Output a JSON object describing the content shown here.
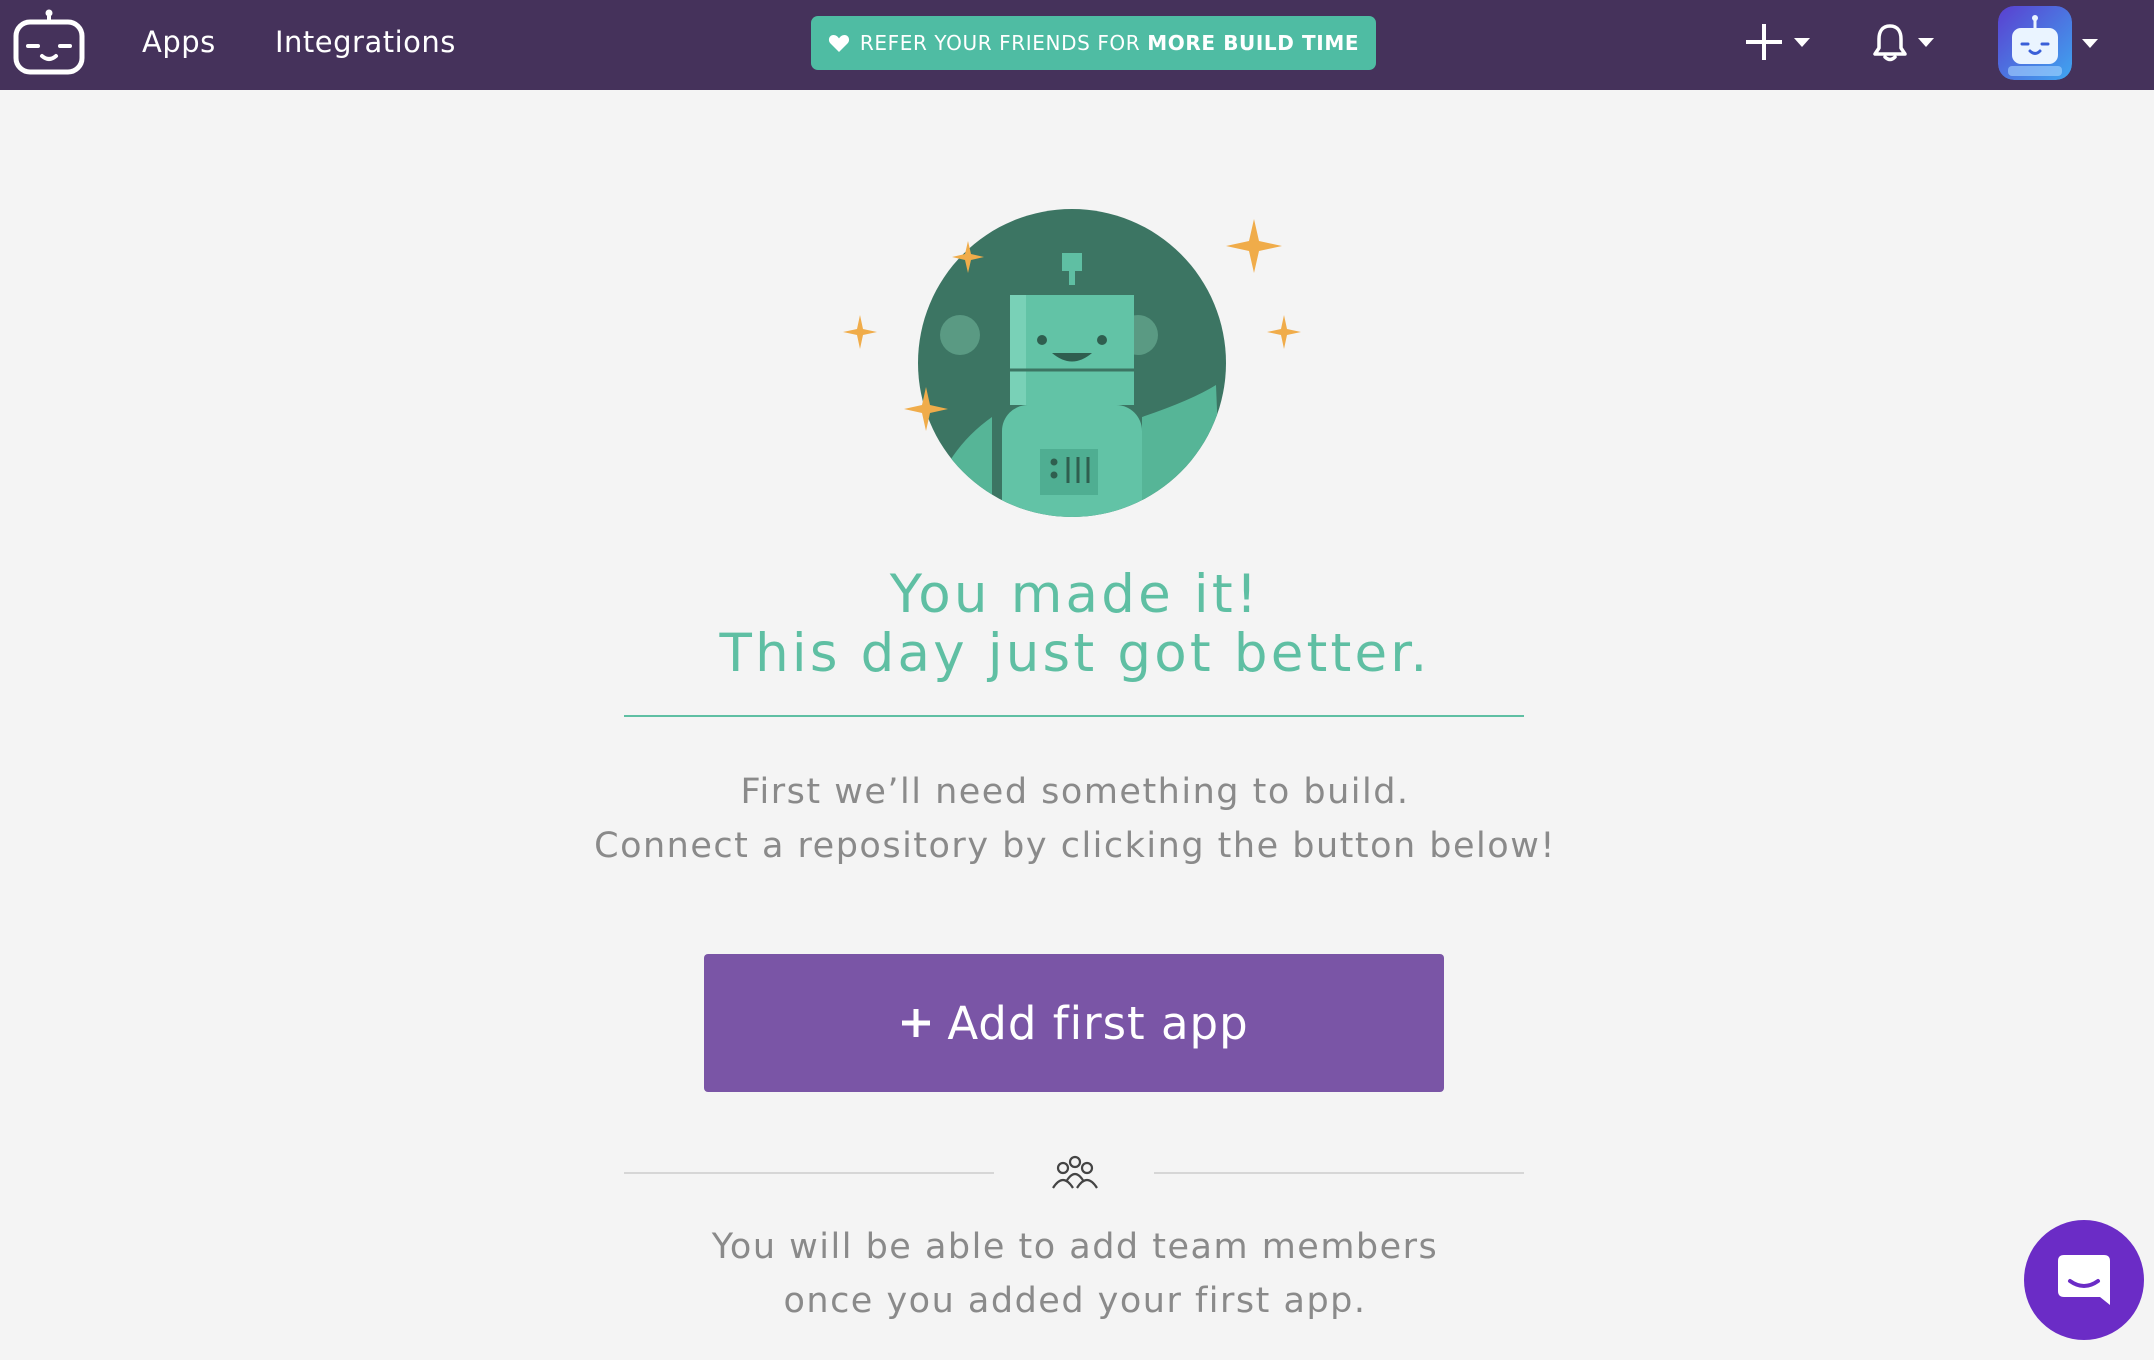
{
  "nav": {
    "logo_icon": "bitrise-bot-logo-icon",
    "links": [
      "Apps",
      "Integrations"
    ],
    "refer": {
      "prefix": "REFER YOUR FRIENDS FOR",
      "emphasis": "MORE BUILD TIME",
      "icon": "heart-icon"
    },
    "actions": {
      "add_icon": "plus-icon",
      "notifications_icon": "bell-icon",
      "avatar_icon": "robot-avatar",
      "dropdown_icon": "caret-down-icon"
    }
  },
  "main": {
    "illustration": "robot-with-sparkles",
    "headline_line1": "You made it!",
    "headline_line2": "This day just got better.",
    "subtext_line1": "First we’ll need something to build.",
    "subtext_line2": "Connect a repository by clicking the button below!",
    "add_button_label": "Add first app",
    "add_button_icon": "plus-icon",
    "team_icon": "team-members-icon",
    "team_text_line1": "You will be able to add team members",
    "team_text_line2": "once you added your first app."
  },
  "support": {
    "chat_icon": "chat-bubble-icon"
  },
  "colors": {
    "topbar": "#45325b",
    "accent_green": "#5fbfa3",
    "refer_green": "#4fbca3",
    "button_purple": "#7a55a6",
    "chat_purple": "#6b2cc6",
    "sparkle": "#f0ac4a",
    "illustration_dark": "#3c7563",
    "body_text": "#8a8a8a"
  }
}
